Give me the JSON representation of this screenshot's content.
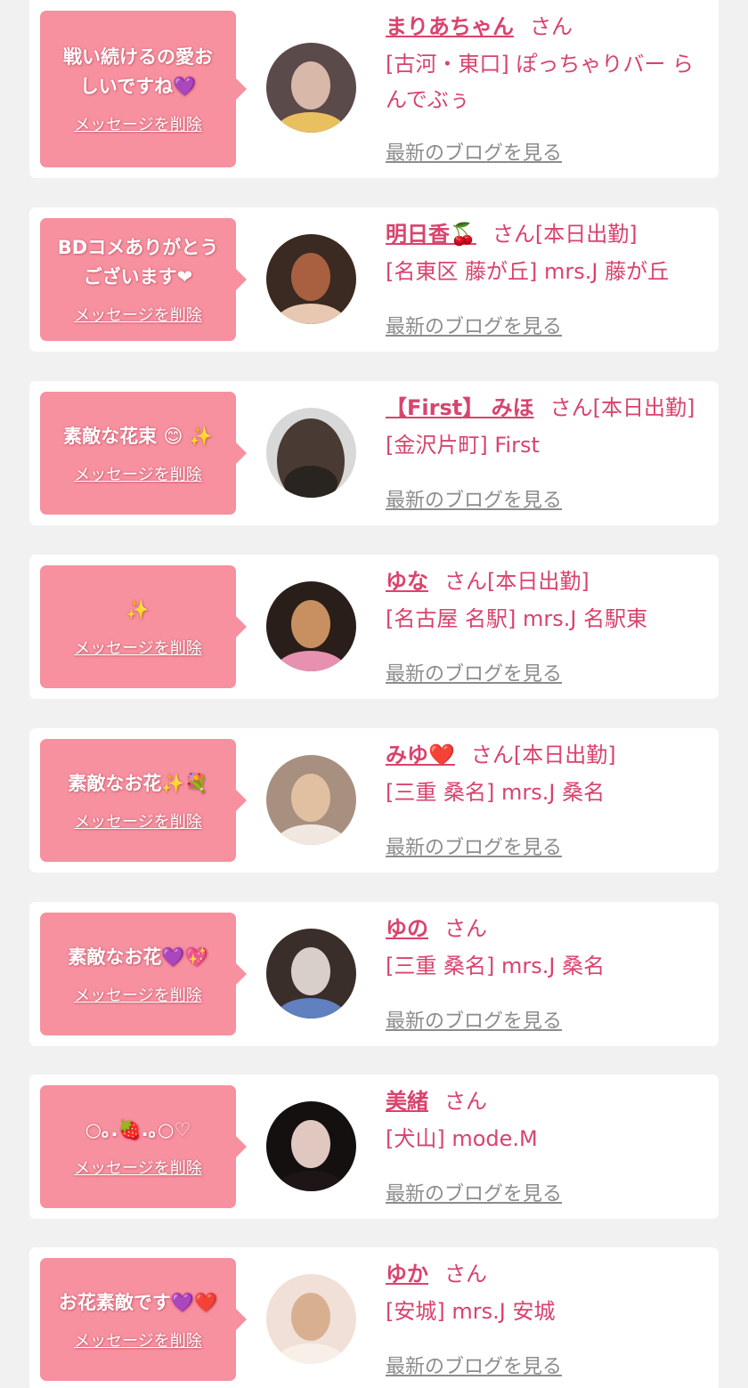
{
  "colors": {
    "page_background": "#f1f1f1",
    "card": "#ffffff",
    "bubble": "#f7909f",
    "name_text": "#d9436d",
    "blog_link": "#8c8c8c"
  },
  "messages": [
    {
      "message_lines": [
        "戦い続けるの愛お",
        "しいですね💜"
      ],
      "delete_label": "メッセージを削除",
      "name": "まりあちゃん",
      "suffix": "さん",
      "shop": "[古河・東口] ぽっちゃりバー らんでぶぅ",
      "blog_label": "最新のブログを見る",
      "avatar_icon": "avatar-photo-happy-text",
      "avatar_colors": [
        "#5a4a4a",
        "#d8b8a8",
        "#e8c060"
      ]
    },
    {
      "message_lines": [
        "BDコメありがとう",
        "ございます❤"
      ],
      "delete_label": "メッセージを削除",
      "name": "明日香🍒",
      "suffix": "さん[本日出勤]",
      "shop": "[名東区 藤が丘] mrs.J 藤が丘",
      "blog_label": "最新のブログを見る",
      "avatar_icon": "avatar-photo-woman-auburn-hair",
      "avatar_colors": [
        "#3a2a22",
        "#a86040",
        "#e8c8b0"
      ]
    },
    {
      "message_lines": [
        "素敵な花束 😊 ✨"
      ],
      "delete_label": "メッセージを削除",
      "name": "【First】 みほ",
      "suffix": "さん[本日出勤]",
      "shop": "[金沢片町] First",
      "blog_label": "最新のブログを見る",
      "avatar_icon": "avatar-photo-curly-hair-back",
      "avatar_colors": [
        "#d8d8d8",
        "#4a3a34",
        "#2a2420"
      ]
    },
    {
      "message_lines": [
        "✨"
      ],
      "delete_label": "メッセージを削除",
      "name": "ゆな",
      "suffix": "さん[本日出勤]",
      "shop": "[名古屋 名駅] mrs.J 名駅東",
      "blog_label": "最新のブログを見る",
      "avatar_icon": "avatar-photo-pink-mask",
      "avatar_colors": [
        "#2a1e1a",
        "#c89060",
        "#e890b0"
      ]
    },
    {
      "message_lines": [
        "素敵なお花✨💐"
      ],
      "delete_label": "メッセージを削除",
      "name": "みゆ❤️",
      "suffix": "さん[本日出勤]",
      "shop": "[三重 桑名] mrs.J 桑名",
      "blog_label": "最新のブログを見る",
      "avatar_icon": "avatar-photo-blonde-curls",
      "avatar_colors": [
        "#a89080",
        "#e0c0a0",
        "#f0e8e0"
      ]
    },
    {
      "message_lines": [
        "素敵なお花💜💖"
      ],
      "delete_label": "メッセージを削除",
      "name": "ゆの",
      "suffix": "さん",
      "shop": "[三重 桑名] mrs.J 桑名",
      "blog_label": "最新のブログを見る",
      "avatar_icon": "avatar-photo-card-over-face",
      "avatar_colors": [
        "#3a2e2a",
        "#d8d0c8",
        "#6080c0"
      ]
    },
    {
      "message_lines": [
        "○｡.🍓.｡○♡"
      ],
      "delete_label": "メッセージを削除",
      "name": "美緒",
      "suffix": "さん",
      "shop": "[犬山] mode.M",
      "blog_label": "最新のブログを見る",
      "avatar_icon": "avatar-photo-dark-hair-bangs",
      "avatar_colors": [
        "#141010",
        "#e0c8c0",
        "#1e1616"
      ]
    },
    {
      "message_lines": [
        "お花素敵です💜❤️"
      ],
      "delete_label": "メッセージを削除",
      "name": "ゆか",
      "suffix": "さん",
      "shop": "[安城] mrs.J 安城",
      "blog_label": "最新のブログを見る",
      "avatar_icon": "avatar-photo-blonde-selfie",
      "avatar_colors": [
        "#f0e0d8",
        "#d8b090",
        "#f8f0e8"
      ]
    }
  ]
}
